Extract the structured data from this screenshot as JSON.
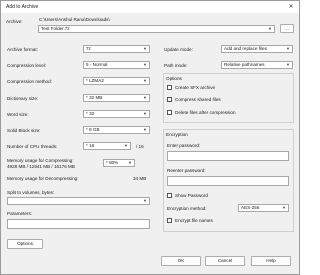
{
  "window": {
    "title": "Add to Archive",
    "close_glyph": "✕"
  },
  "archive": {
    "label": "Archive:",
    "path": "C:\\Users\\Anshul Rana\\Downloads\\",
    "name": "Test Folder.7z",
    "browse_label": "..."
  },
  "left": {
    "format_label": "Archive format:",
    "format_value": "7z",
    "level_label": "Compression level:",
    "level_value": "5 - Normal",
    "method_label": "Compression method:",
    "method_value": "* LZMA2",
    "dict_label": "Dictionary size:",
    "dict_value": "* 32 MB",
    "word_label": "Word size:",
    "word_value": "* 32",
    "solid_label": "Solid Block size:",
    "solid_value": "* 8 GB",
    "threads_label": "Number of CPU threads:",
    "threads_value": "* 16",
    "threads_total": "/ 16",
    "mem_comp_label": "Memory usage for Compressing:",
    "mem_comp_detail": "4928 MB / 12941 MB / 16176 MB",
    "mem_comp_value": "* 80%",
    "mem_decomp_label": "Memory usage for Decompressing:",
    "mem_decomp_value": "34 MB",
    "split_label": "Split to volumes, bytes:",
    "split_value": "",
    "params_label": "Parameters:",
    "params_value": "",
    "options_button": "Options"
  },
  "right": {
    "update_label": "Update mode:",
    "update_value": "Add and replace files",
    "pathmode_label": "Path mode:",
    "pathmode_value": "Relative pathnames",
    "options_title": "Options",
    "opt_sfx": "Create SFX archive",
    "opt_shared": "Compress shared files",
    "opt_delete": "Delete files after compression",
    "enc_title": "Encryption",
    "enc_pw_label": "Enter password:",
    "enc_repw_label": "Reenter password:",
    "enc_show": "Show Password",
    "enc_method_label": "Encryption method:",
    "enc_method_value": "AES-256",
    "enc_names": "Encrypt file names"
  },
  "footer": {
    "ok": "OK",
    "cancel": "Cancel",
    "help": "Help"
  }
}
